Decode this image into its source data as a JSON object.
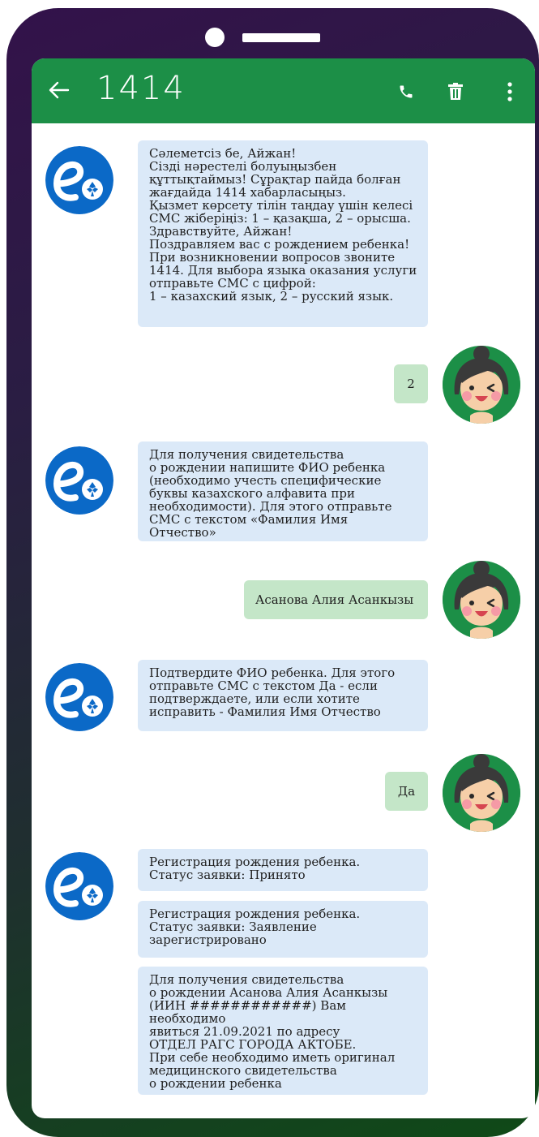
{
  "header": {
    "title": "1414"
  },
  "messages": {
    "m1": "Сәлеметсіз бе, Айжан!\nСізді нәрестелі болуыңызбен\nқұттықтаймыз! Сұрақтар пайда болған\nжағдайда 1414 хабарласыңыз.\nҚызмет көрсету тілін таңдау үшін келесі\nСМС жіберіңіз: 1 – қазақша, 2 – орысша.\nЗдравствуйте, Айжан!\nПоздравляем вас с рождением ребенка!\nПри возникновении вопросов звоните\n1414. Для выбора языка оказания услуги\nотправьте СМС с цифрой:\n1 – казахский язык, 2 – русский язык.",
    "r1": "2",
    "m2": "Для получения свидетельства\nо рождении напишите ФИО ребенка\n(необходимо учесть специфические\nбуквы казахского алфавита при\nнеобходимости). Для этого отправьте\nСМС с текстом «Фамилия Имя Отчество»",
    "r2": "Асанова Алия Асанкызы",
    "m3": "Подтвердите ФИО ребенка. Для этого\nотправьте СМС с текстом Да - если\nподтверждаете, или если хотите\nисправить - Фамилия Имя Отчество",
    "r3": "Да",
    "m4": "Регистрация рождения ребенка.\nСтатус заявки: Принято",
    "m5": "Регистрация рождения ребенка.\nСтатус заявки: Заявление\nзарегистрировано",
    "m6": "Для получения свидетельства\nо рождении Асанова Алия Асанкызы\n(ИИН ############) Вам необходимо\nявиться 21.09.2021 по адресу\nОТДЕЛ РАГС ГОРОДА АКТОБЕ.\nПри себе необходимо иметь оригинал\nмедицинского свидетельства\nо рождении ребенка"
  },
  "icons": {
    "back": "arrow-left-icon",
    "call": "phone-icon",
    "delete": "trash-icon",
    "menu": "more-vertical-icon",
    "bot_avatar": "egov-logo-icon",
    "user_avatar": "user-avatar-icon"
  },
  "colors": {
    "appbar": "#1c8f47",
    "incoming_bubble": "#dbe9f8",
    "outgoing_bubble": "#c4e6c8",
    "bot_avatar": "#0b69c7"
  }
}
